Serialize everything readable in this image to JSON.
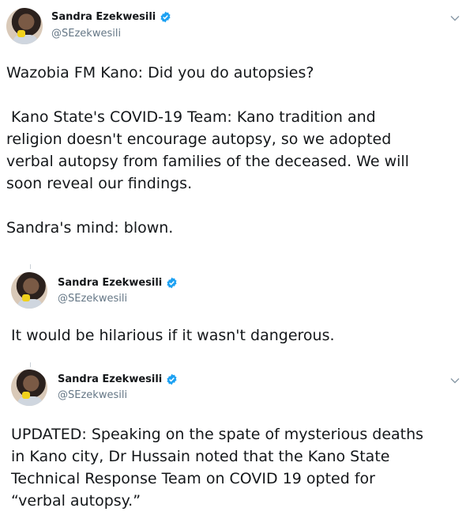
{
  "icons": {
    "verified": "verified-badge-icon",
    "more": "chevron-down-icon"
  },
  "colors": {
    "verified_blue": "#1da1f2",
    "secondary_text": "#657786",
    "primary_text": "#14171a"
  },
  "tweets": [
    {
      "author_name": "Sandra Ezekwesili",
      "author_handle": "@SEzekwesili",
      "body": "Wazobia FM Kano: Did you do autopsies?\n\n Kano State's COVID-19 Team: Kano tradition and\nreligion doesn't encourage autopsy, so we adopted\nverbal autopsy from families of the deceased. We will\nsoon reveal our findings.\n\nSandra's mind: blown."
    },
    {
      "author_name": "Sandra Ezekwesili",
      "author_handle": "@SEzekwesili",
      "body": "It would be hilarious if it wasn't dangerous."
    },
    {
      "author_name": "Sandra Ezekwesili",
      "author_handle": "@SEzekwesili",
      "body": "UPDATED: Speaking on the spate of mysterious deaths\nin Kano city, Dr Hussain noted that the Kano State\nTechnical Response Team on COVID 19 opted for\n“verbal autopsy.”"
    }
  ]
}
